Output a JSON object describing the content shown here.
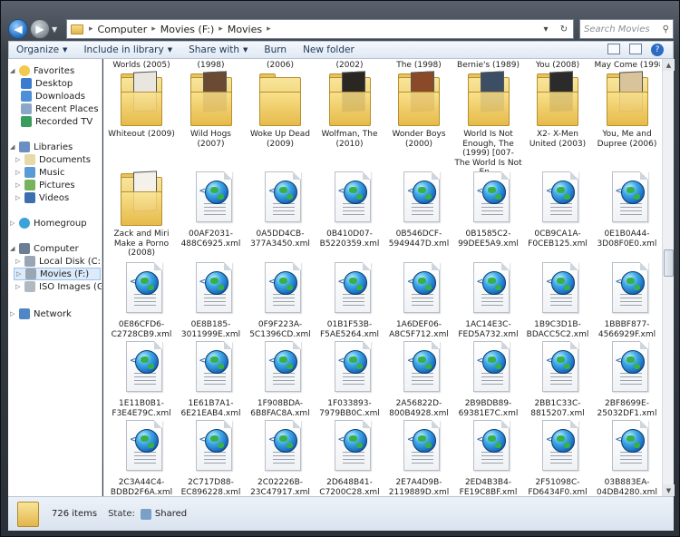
{
  "address": {
    "segments": [
      "Computer",
      "Movies (F:)",
      "Movies"
    ]
  },
  "search": {
    "placeholder": "Search Movies"
  },
  "toolbar": {
    "organize": "Organize",
    "include": "Include in library",
    "share": "Share with",
    "burn": "Burn",
    "new_folder": "New folder"
  },
  "nav": {
    "favorites": "Favorites",
    "desktop": "Desktop",
    "downloads": "Downloads",
    "recent": "Recent Places",
    "recorded": "Recorded TV",
    "libraries": "Libraries",
    "documents": "Documents",
    "music": "Music",
    "pictures": "Pictures",
    "videos": "Videos",
    "homegroup": "Homegroup",
    "computer": "Computer",
    "local": "Local Disk (C:)",
    "movies": "Movies (F:)",
    "iso": "ISO Images (G:)",
    "network": "Network"
  },
  "top_partial": [
    "Worlds (2005)",
    "(1998)",
    "(2006)",
    "(2002)",
    "The (1998)",
    "Bernie's (1989)",
    "You (2008)",
    "May Come (1998)"
  ],
  "folders": [
    {
      "label": "Whiteout (2009)",
      "poster": "#e9e6e0"
    },
    {
      "label": "Wild Hogs (2007)",
      "poster": "#6b4a33"
    },
    {
      "label": "Woke Up Dead (2009)",
      "poster": ""
    },
    {
      "label": "Wolfman, The (2010)",
      "poster": "#2a2622"
    },
    {
      "label": "Wonder Boys (2000)",
      "poster": "#8a4a2a"
    },
    {
      "label": "World Is Not Enough, The (1999) [007- The World Is Not En...",
      "poster": "#3c4d66"
    },
    {
      "label": "X2- X-Men United (2003)",
      "poster": "#2b2b2b"
    },
    {
      "label": "You, Me and Dupree (2006)",
      "poster": "#d9c39a"
    },
    {
      "label": "Zack and Miri Make a Porno (2008)",
      "poster": "#f4f1ea"
    }
  ],
  "files": [
    "00AF2031-488C6925.xml",
    "0A5DD4CB-377A3450.xml",
    "0B410D07-B5220359.xml",
    "0B546DCF-5949447D.xml",
    "0B1585C2-99DEE5A9.xml",
    "0CB9CA1A-F0CEB125.xml",
    "0E1B0A44-3D08F0E0.xml",
    "0E86CFD6-C2728CB9.xml",
    "0E8B185-3011999E.xml",
    "0F9F223A-5C1396CD.xml",
    "01B1F53B-F5AE5264.xml",
    "1A6DEF06-A8C5F712.xml",
    "1AC14E3C-FED5A732.xml",
    "1B9C3D1B-BDACC5C2.xml",
    "1BBBF877-4566929F.xml",
    "1E11B0B1-F3E4E79C.xml",
    "1E61B7A1-6E21EAB4.xml",
    "1F908BDA-6B8FAC8A.xml",
    "1F033893-7979BB0C.xml",
    "2A56822D-800B4928.xml",
    "2B9BDB89-69381E7C.xml",
    "2BB1C33C-8815207.xml",
    "2BF8699E-25032DF1.xml",
    "2C3A44C4-BDBD2F6A.xml",
    "2C717D88-EC896228.xml",
    "2C02226B-23C47917.xml",
    "2D648B41-C7200C28.xml",
    "2E7A4D9B-2119889D.xml",
    "2ED4B3B4-FE19C8BF.xml",
    "2F51098C-FD6434F0.xml",
    "03B883EA-04DB4280.xml"
  ],
  "status": {
    "count": "726 items",
    "state_label": "State:",
    "state_value": "Shared"
  }
}
